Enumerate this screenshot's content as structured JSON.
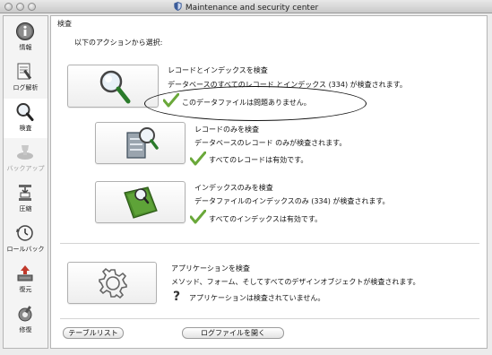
{
  "window": {
    "title": "Maintenance and security center"
  },
  "sidebar": {
    "items": [
      {
        "label": "情報",
        "icon": "info-icon",
        "active": false,
        "enabled": true
      },
      {
        "label": "ログ解析",
        "icon": "log-analysis-icon",
        "active": false,
        "enabled": true
      },
      {
        "label": "検査",
        "icon": "magnifier-icon",
        "active": true,
        "enabled": true
      },
      {
        "label": "バックアップ",
        "icon": "backup-icon",
        "active": false,
        "enabled": false
      },
      {
        "label": "圧縮",
        "icon": "compact-icon",
        "active": false,
        "enabled": true
      },
      {
        "label": "ロールバック",
        "icon": "rollback-icon",
        "active": false,
        "enabled": true
      },
      {
        "label": "復元",
        "icon": "restore-icon",
        "active": false,
        "enabled": true
      },
      {
        "label": "修復",
        "icon": "repair-icon",
        "active": false,
        "enabled": true
      }
    ]
  },
  "main": {
    "section_label": "検査",
    "prompt": "以下のアクションから選択:",
    "actions": [
      {
        "title": "レコードとインデックスを検査",
        "description": "データベースのすべてのレコード とインデックス (334) が検査されます。",
        "status": "このデータファイルは問題ありません。",
        "status_icon": "check-icon"
      },
      {
        "title": "レコードのみを検査",
        "description": "データベースのレコード のみが検査されます。",
        "status": "すべてのレコードは有効です。",
        "status_icon": "check-icon"
      },
      {
        "title": "インデックスのみを検査",
        "description": "データファイルのインデックスのみ (334) が検査されます。",
        "status": "すべてのインデックスは有効です。",
        "status_icon": "check-icon"
      },
      {
        "title": "アプリケーションを検査",
        "description": "メソッド、フォーム、そしてすべてのデザインオブジェクトが検査されます。",
        "status": "アプリケーションは検査されていません。",
        "status_icon": "question-icon",
        "status_glyph": "?"
      }
    ]
  },
  "footer": {
    "table_list_label": "テーブルリスト",
    "open_log_label": "ログファイルを開く"
  },
  "colors": {
    "check_green": "#6aa83a",
    "selection_bg": "#ffffff"
  }
}
